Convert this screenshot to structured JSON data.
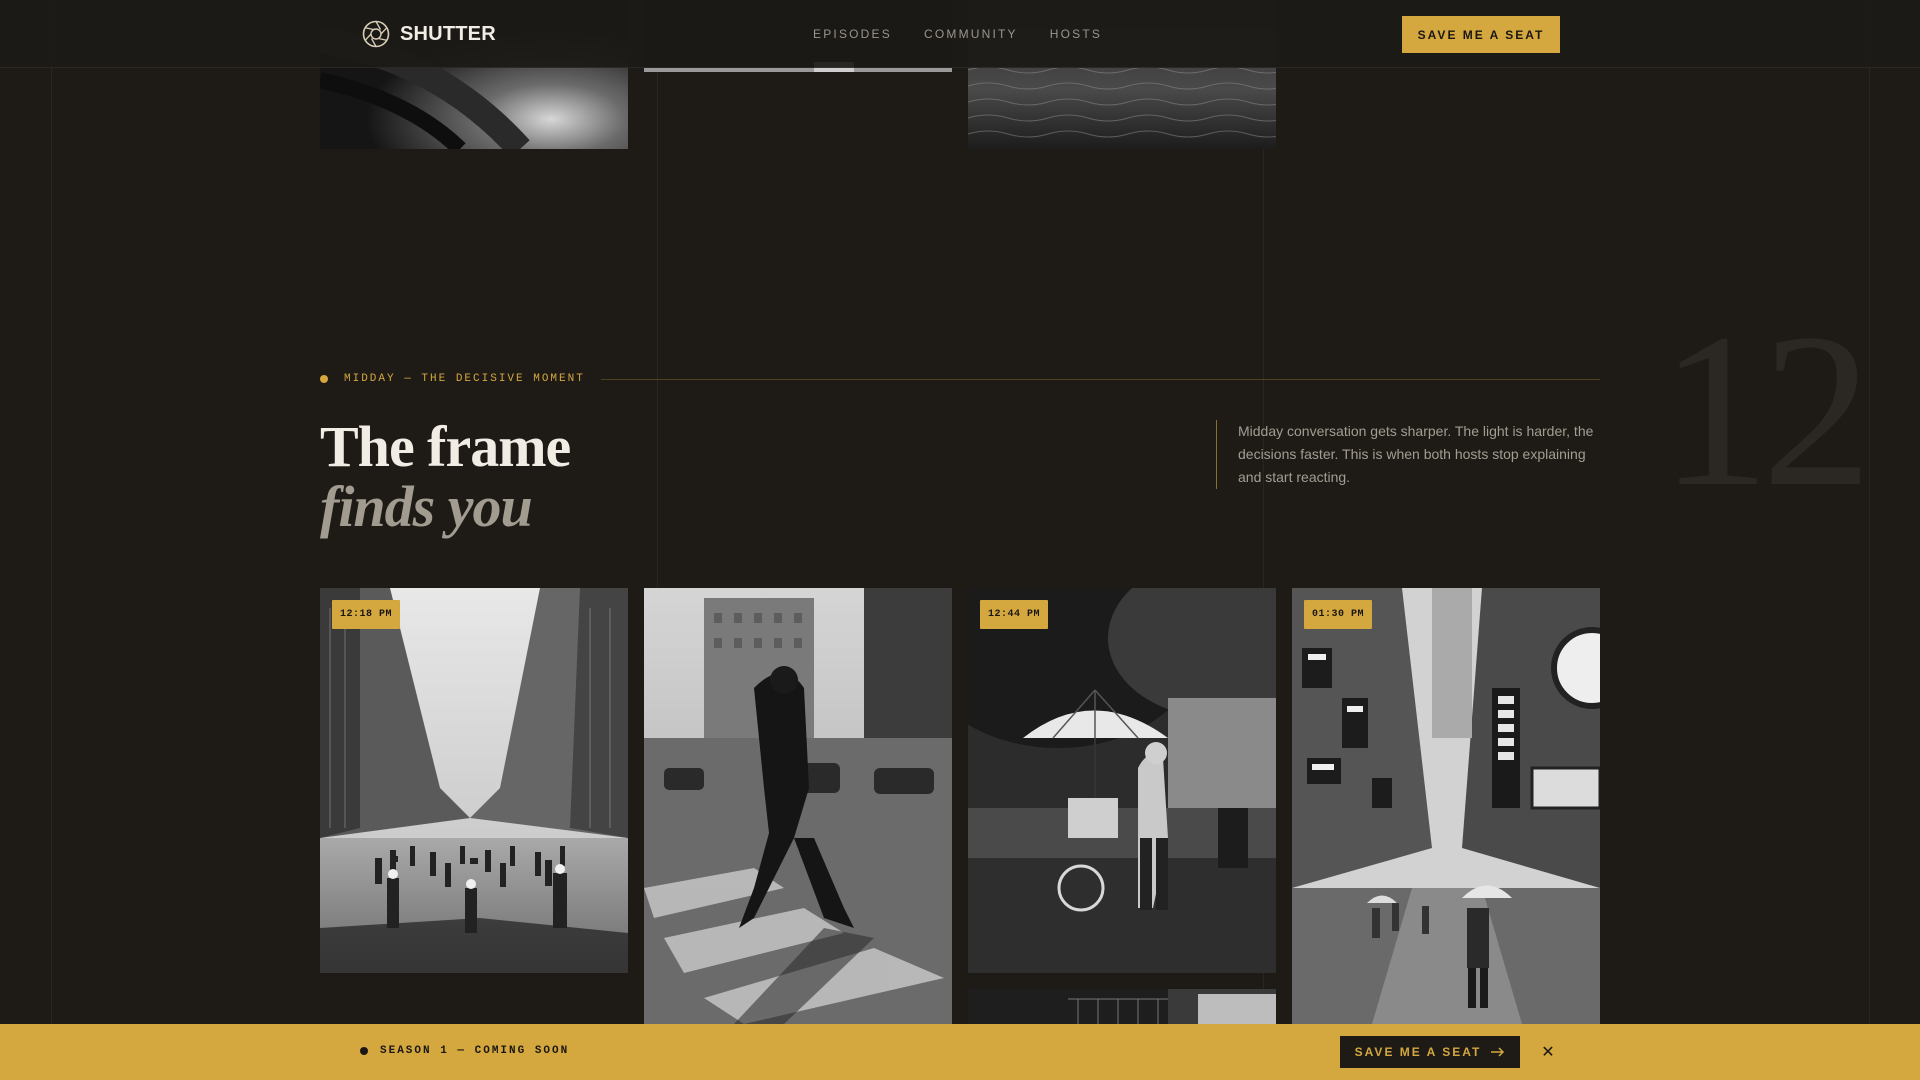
{
  "nav": {
    "brand": "SHUTTER",
    "links": [
      "EPISODES",
      "COMMUNITY",
      "HOSTS"
    ],
    "cta": "SAVE ME A SEAT",
    "brand_icon": "aperture-icon"
  },
  "section": {
    "eyebrow": "MIDDAY — THE DECISIVE MOMENT",
    "title_line1": "The frame",
    "title_line2": "finds you",
    "description": "Midday conversation gets sharper. The light is harder, the decisions faster. This is when both hosts stop explaining and start reacting.",
    "big_number": "12"
  },
  "photos": [
    {
      "time": "12:18 PM"
    },
    {
      "time": ""
    },
    {
      "time": "12:44 PM"
    },
    {
      "time": "01:30 PM"
    }
  ],
  "banner": {
    "text": "SEASON 1 — COMING SOON",
    "cta": "SAVE ME A SEAT",
    "cta_icon": "arrow-right-icon",
    "close_icon": "close-icon"
  },
  "colors": {
    "background": "#1e1b17",
    "accent": "#d4a73f",
    "text": "#e8e4dc",
    "muted": "#a39d92"
  }
}
